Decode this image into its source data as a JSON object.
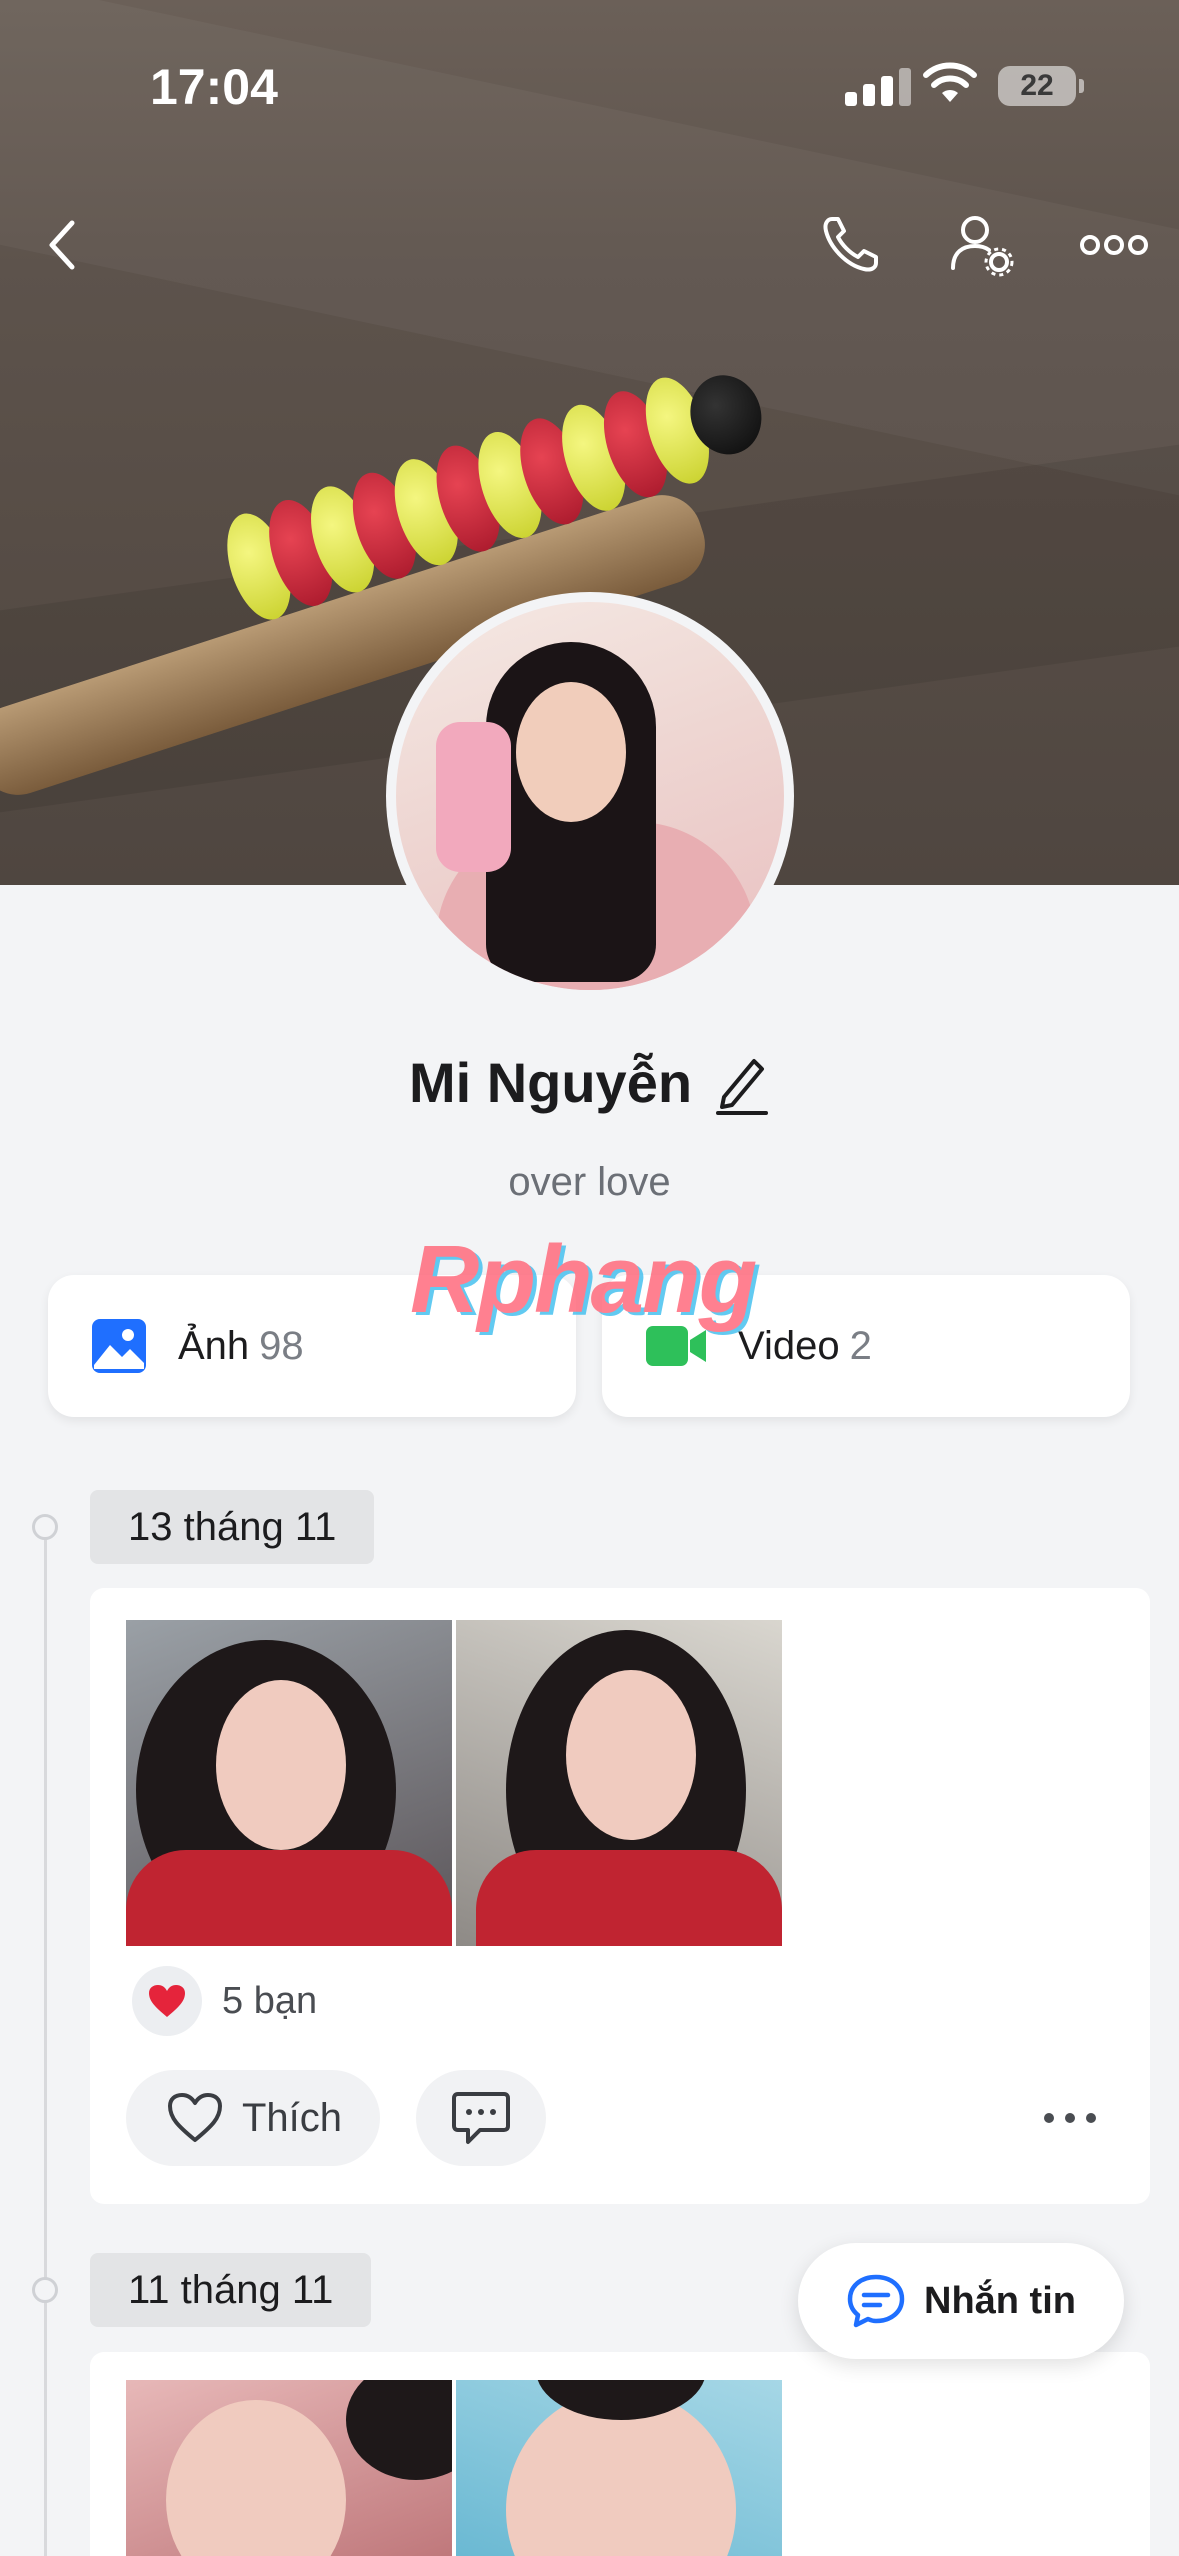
{
  "status_bar": {
    "time": "17:04",
    "battery": "22"
  },
  "profile": {
    "name": "Mi Nguyễn",
    "status": "over love",
    "watermark": "Rphang"
  },
  "media": [
    {
      "label": "Ảnh",
      "count": "98"
    },
    {
      "label": "Video",
      "count": "2"
    }
  ],
  "posts": [
    {
      "date": "13 tháng 11",
      "reaction_text": "5 bạn",
      "like_label": "Thích"
    },
    {
      "date": "11 tháng 11"
    }
  ],
  "fab": {
    "label": "Nhắn tin"
  },
  "colors": {
    "accent": "#1f6fff",
    "video": "#2ec05a",
    "heart": "#e5243b"
  }
}
